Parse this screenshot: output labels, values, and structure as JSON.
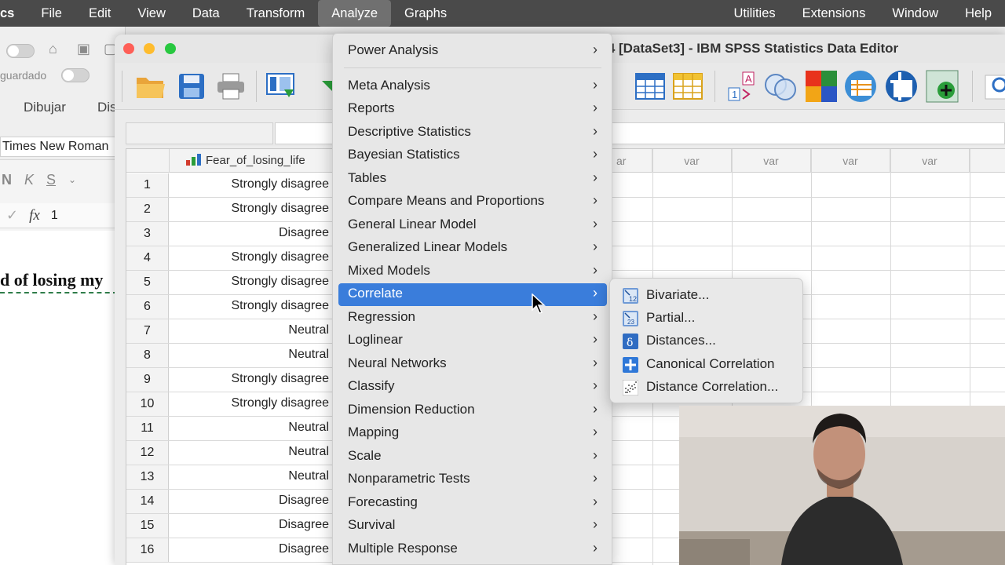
{
  "menubar": {
    "app": "cs",
    "items": [
      "File",
      "Edit",
      "View",
      "Data",
      "Transform",
      "Analyze",
      "Graphs"
    ],
    "active": "Analyze",
    "right_items": [
      "Utilities",
      "Extensions",
      "Window",
      "Help"
    ]
  },
  "word": {
    "autosave_label": "guardado",
    "tab_draw": "Dibujar",
    "tab_partial": "Dis",
    "font_name": "Times New Roman",
    "fmt_italic": "K",
    "fmt_underline": "S",
    "fmt_bold": "N",
    "formula_symbol": "fx",
    "formula_value": "1",
    "doc_text": "d of losing my"
  },
  "spss": {
    "title": "ed4 [DataSet3] - IBM SPSS Statistics Data Editor"
  },
  "grid": {
    "column_header": "Fear_of_losing_life",
    "var_label": "var",
    "partial_var_label": "ar",
    "rows": [
      {
        "n": "1",
        "value": "Strongly disagree"
      },
      {
        "n": "2",
        "value": "Strongly disagree"
      },
      {
        "n": "3",
        "value": "Disagree"
      },
      {
        "n": "4",
        "value": "Strongly disagree"
      },
      {
        "n": "5",
        "value": "Strongly disagree"
      },
      {
        "n": "6",
        "value": "Strongly disagree"
      },
      {
        "n": "7",
        "value": "Neutral"
      },
      {
        "n": "8",
        "value": "Neutral"
      },
      {
        "n": "9",
        "value": "Strongly disagree"
      },
      {
        "n": "10",
        "value": "Strongly disagree"
      },
      {
        "n": "11",
        "value": "Neutral"
      },
      {
        "n": "12",
        "value": "Neutral"
      },
      {
        "n": "13",
        "value": "Neutral"
      },
      {
        "n": "14",
        "value": "Disagree"
      },
      {
        "n": "15",
        "value": "Disagree"
      },
      {
        "n": "16",
        "value": "Disagree"
      }
    ]
  },
  "analyze_menu": {
    "items": [
      "Power Analysis",
      "Meta Analysis",
      "Reports",
      "Descriptive Statistics",
      "Bayesian Statistics",
      "Tables",
      "Compare Means and Proportions",
      "General Linear Model",
      "Generalized Linear Models",
      "Mixed Models",
      "Correlate",
      "Regression",
      "Loglinear",
      "Neural Networks",
      "Classify",
      "Dimension Reduction",
      "Mapping",
      "Scale",
      "Nonparametric Tests",
      "Forecasting",
      "Survival",
      "Multiple Response"
    ],
    "highlighted": "Correlate",
    "submenu_arrow": "›"
  },
  "correlate_submenu": {
    "items": [
      {
        "label": "Bivariate...",
        "icon": "bivariate-icon"
      },
      {
        "label": "Partial...",
        "icon": "partial-icon"
      },
      {
        "label": "Distances...",
        "icon": "distances-icon"
      },
      {
        "label": "Canonical Correlation",
        "icon": "canonical-icon"
      },
      {
        "label": "Distance Correlation...",
        "icon": "distance-correlation-icon"
      }
    ]
  },
  "colors": {
    "highlight": "#3a7ddb",
    "menubar": "#4a4a4a"
  }
}
